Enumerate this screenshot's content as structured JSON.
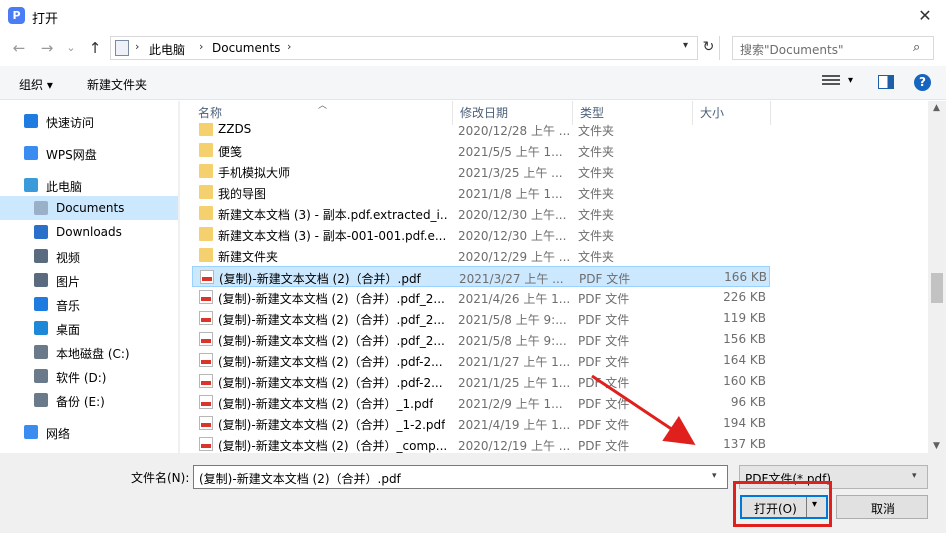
{
  "window": {
    "title": "打开",
    "app_icon_glyph": "P",
    "close_glyph": "✕"
  },
  "nav": {
    "back_glyph": "←",
    "forward_glyph": "→",
    "recent_glyph": "⌄",
    "up_glyph": "↑",
    "breadcrumb": [
      "此电脑",
      "Documents"
    ],
    "separator_glyph": "›",
    "refresh_glyph": "↻",
    "search_placeholder": "搜索\"Documents\"",
    "search_glyph": "⌕"
  },
  "toolbar": {
    "organize_label": "组织 ▾",
    "new_folder_label": "新建文件夹",
    "help_glyph": "?"
  },
  "sidebar": {
    "items": [
      {
        "label": "快速访问",
        "icon": "star-icon",
        "color": "#1e7be0"
      },
      {
        "label": "WPS网盘",
        "icon": "cloud-icon",
        "color": "#3b8cf0"
      },
      {
        "label": "此电脑",
        "icon": "computer-icon",
        "color": "#3b9ad9"
      },
      {
        "label": "Documents",
        "icon": "document-icon",
        "color": "#9ab0c8"
      },
      {
        "label": "Downloads",
        "icon": "download-icon",
        "color": "#2a6fc9"
      },
      {
        "label": "视频",
        "icon": "video-icon",
        "color": "#5a6b80"
      },
      {
        "label": "图片",
        "icon": "picture-icon",
        "color": "#5a6b80"
      },
      {
        "label": "音乐",
        "icon": "music-icon",
        "color": "#1e7be0"
      },
      {
        "label": "桌面",
        "icon": "desktop-icon",
        "color": "#1e88d8"
      },
      {
        "label": "本地磁盘 (C:)",
        "icon": "drive-icon",
        "color": "#6a7a8a"
      },
      {
        "label": "软件 (D:)",
        "icon": "drive-icon",
        "color": "#6a7a8a"
      },
      {
        "label": "备份 (E:)",
        "icon": "drive-icon",
        "color": "#6a7a8a"
      },
      {
        "label": "网络",
        "icon": "network-icon",
        "color": "#3b8cf0"
      }
    ],
    "selected_index": 3
  },
  "columns": {
    "name": "名称",
    "date": "修改日期",
    "type": "类型",
    "size": "大小"
  },
  "files": [
    {
      "name": "ZZDS",
      "date": "2020/12/28 上午 ...",
      "type": "文件夹",
      "size": "",
      "kind": "folder"
    },
    {
      "name": "便笺",
      "date": "2021/5/5 上午 1...",
      "type": "文件夹",
      "size": "",
      "kind": "folder"
    },
    {
      "name": "手机模拟大师",
      "date": "2021/3/25 上午 ...",
      "type": "文件夹",
      "size": "",
      "kind": "folder"
    },
    {
      "name": "我的导图",
      "date": "2021/1/8 上午 1...",
      "type": "文件夹",
      "size": "",
      "kind": "folder"
    },
    {
      "name": "新建文本文档 (3) - 副本.pdf.extracted_i...",
      "date": "2020/12/30 上午...",
      "type": "文件夹",
      "size": "",
      "kind": "folder"
    },
    {
      "name": "新建文本文档 (3) - 副本-001-001.pdf.e...",
      "date": "2020/12/30 上午...",
      "type": "文件夹",
      "size": "",
      "kind": "folder"
    },
    {
      "name": "新建文件夹",
      "date": "2020/12/29 上午 ...",
      "type": "文件夹",
      "size": "",
      "kind": "folder"
    },
    {
      "name": "(复制)-新建文本文档 (2)（合并）.pdf",
      "date": "2021/3/27 上午 ...",
      "type": "PDF 文件",
      "size": "166 KB",
      "kind": "pdf"
    },
    {
      "name": "(复制)-新建文本文档 (2)（合并）.pdf_2...",
      "date": "2021/4/26 上午 1...",
      "type": "PDF 文件",
      "size": "226 KB",
      "kind": "pdf"
    },
    {
      "name": "(复制)-新建文本文档 (2)（合并）.pdf_2...",
      "date": "2021/5/8 上午 9:...",
      "type": "PDF 文件",
      "size": "119 KB",
      "kind": "pdf"
    },
    {
      "name": "(复制)-新建文本文档 (2)（合并）.pdf_2...",
      "date": "2021/5/8 上午 9:...",
      "type": "PDF 文件",
      "size": "156 KB",
      "kind": "pdf"
    },
    {
      "name": "(复制)-新建文本文档 (2)（合并）.pdf-2...",
      "date": "2021/1/27 上午 1...",
      "type": "PDF 文件",
      "size": "164 KB",
      "kind": "pdf"
    },
    {
      "name": "(复制)-新建文本文档 (2)（合并）.pdf-2...",
      "date": "2021/1/25 上午 1...",
      "type": "PDF 文件",
      "size": "160 KB",
      "kind": "pdf"
    },
    {
      "name": "(复制)-新建文本文档 (2)（合并）_1.pdf",
      "date": "2021/2/9 上午 1...",
      "type": "PDF 文件",
      "size": "96 KB",
      "kind": "pdf"
    },
    {
      "name": "(复制)-新建文本文档 (2)（合并）_1-2.pdf",
      "date": "2021/4/19 上午 1...",
      "type": "PDF 文件",
      "size": "194 KB",
      "kind": "pdf"
    },
    {
      "name": "(复制)-新建文本文档 (2)（合并）_comp...",
      "date": "2020/12/19 上午 ...",
      "type": "PDF 文件",
      "size": "137 KB",
      "kind": "pdf"
    }
  ],
  "selected_file_index": 7,
  "footer": {
    "filename_label": "文件名(N):",
    "filename_value": "(复制)-新建文本文档 (2)（合并）.pdf",
    "filter_value": "PDF文件(*.pdf)",
    "open_label": "打开(O)",
    "cancel_label": "取消",
    "dropdown_glyph": "▾"
  },
  "accent_color": "#0078d7",
  "annotation_color": "#e0201c"
}
